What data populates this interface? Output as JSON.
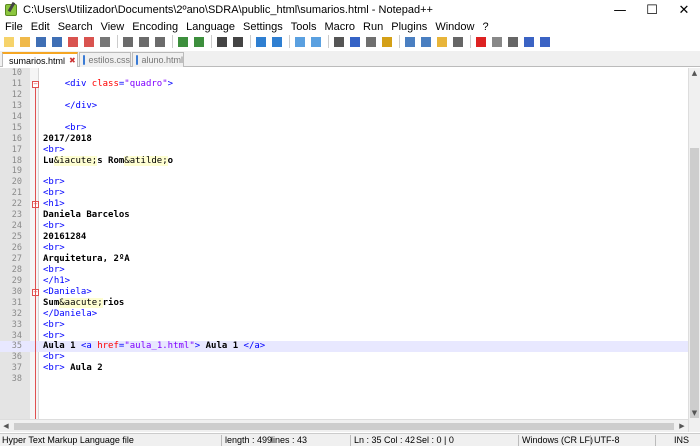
{
  "window": {
    "title": "C:\\Users\\Utilizador\\Documents\\2ºano\\SDRA\\public_html\\sumarios.html - Notepad++",
    "minimize": "—",
    "maximize": "☐",
    "close": "✕"
  },
  "menu": [
    "File",
    "Edit",
    "Search",
    "View",
    "Encoding",
    "Language",
    "Settings",
    "Tools",
    "Macro",
    "Run",
    "Plugins",
    "Window",
    "?"
  ],
  "toolbar_icons": [
    "new-icon",
    "open-icon",
    "save-icon",
    "save-all-icon",
    "close-icon",
    "close-all-icon",
    "print-icon",
    "cut-icon",
    "copy-icon",
    "paste-icon",
    "undo-icon",
    "redo-icon",
    "find-icon",
    "replace-icon",
    "zoom-in-icon",
    "zoom-out-icon",
    "sync-v-icon",
    "sync-h-icon",
    "wrap-icon",
    "all-chars-icon",
    "indent-guide-icon",
    "udl-icon",
    "doc-map-icon",
    "function-list-icon",
    "folder-workspace-icon",
    "monitor-icon",
    "record-icon",
    "stop-icon",
    "play-icon",
    "play-multiple-icon",
    "save-macro-icon"
  ],
  "tabs": [
    {
      "label": "sumarios.html",
      "active": true
    },
    {
      "label": "estilos.css",
      "active": false
    },
    {
      "label": "aluno.html",
      "active": false
    }
  ],
  "code_lines": [
    {
      "n": "10",
      "tokens": []
    },
    {
      "n": "11",
      "tokens": [
        [
          "    ",
          "t"
        ],
        [
          "<div ",
          "tag"
        ],
        [
          "class",
          "attr"
        ],
        [
          "=",
          "tag"
        ],
        [
          "\"quadro\"",
          "str"
        ],
        [
          ">",
          "tag"
        ]
      ]
    },
    {
      "n": "12",
      "tokens": []
    },
    {
      "n": "13",
      "tokens": [
        [
          "    ",
          "t"
        ],
        [
          "</div>",
          "tag"
        ]
      ]
    },
    {
      "n": "14",
      "tokens": []
    },
    {
      "n": "15",
      "tokens": [
        [
          "    ",
          "t"
        ],
        [
          "<br>",
          "tag"
        ]
      ]
    },
    {
      "n": "16",
      "tokens": [
        [
          "2017/2018",
          "txt"
        ]
      ]
    },
    {
      "n": "17",
      "tokens": [
        [
          "<br>",
          "tag"
        ]
      ]
    },
    {
      "n": "18",
      "tokens": [
        [
          "Lu",
          "txt"
        ],
        [
          "&iacute;",
          "ent"
        ],
        [
          "s Rom",
          "txt"
        ],
        [
          "&atilde;",
          "ent"
        ],
        [
          "o",
          "txt"
        ]
      ]
    },
    {
      "n": "19",
      "tokens": []
    },
    {
      "n": "20",
      "tokens": [
        [
          "<br>",
          "tag"
        ]
      ]
    },
    {
      "n": "21",
      "tokens": [
        [
          "<br>",
          "tag"
        ]
      ]
    },
    {
      "n": "22",
      "tokens": [
        [
          "<h1>",
          "tag"
        ]
      ]
    },
    {
      "n": "23",
      "tokens": [
        [
          "Daniela Barcelos",
          "txt"
        ]
      ]
    },
    {
      "n": "24",
      "tokens": [
        [
          "<br>",
          "tag"
        ]
      ]
    },
    {
      "n": "25",
      "tokens": [
        [
          "20161284",
          "txt"
        ]
      ]
    },
    {
      "n": "26",
      "tokens": [
        [
          "<br>",
          "tag"
        ]
      ]
    },
    {
      "n": "27",
      "tokens": [
        [
          "Arquitetura, 2ºA",
          "txt"
        ]
      ]
    },
    {
      "n": "28",
      "tokens": [
        [
          "<br>",
          "tag"
        ]
      ]
    },
    {
      "n": "29",
      "tokens": [
        [
          "</h1>",
          "tag"
        ]
      ]
    },
    {
      "n": "30",
      "tokens": [
        [
          "<Daniela>",
          "tag"
        ]
      ]
    },
    {
      "n": "31",
      "tokens": [
        [
          "Sum",
          "txt"
        ],
        [
          "&aacute;",
          "ent"
        ],
        [
          "rios",
          "txt"
        ]
      ]
    },
    {
      "n": "32",
      "tokens": [
        [
          "</Daniela>",
          "tag"
        ]
      ]
    },
    {
      "n": "33",
      "tokens": [
        [
          "<br>",
          "tag"
        ]
      ]
    },
    {
      "n": "34",
      "tokens": [
        [
          "<br>",
          "tag"
        ]
      ]
    },
    {
      "n": "35",
      "tokens": [
        [
          "Aula 1 ",
          "txt"
        ],
        [
          "<a ",
          "tag"
        ],
        [
          "href",
          "attr"
        ],
        [
          "=",
          "tag"
        ],
        [
          "\"aula_1.html\"",
          "str"
        ],
        [
          ">",
          "tag"
        ],
        [
          " Aula 1 ",
          "txt"
        ],
        [
          "</a>",
          "tag"
        ]
      ],
      "current": true
    },
    {
      "n": "36",
      "tokens": [
        [
          "<br>",
          "tag"
        ]
      ]
    },
    {
      "n": "37",
      "tokens": [
        [
          "<br>",
          "tag"
        ],
        [
          " Aula 2",
          "txt"
        ]
      ]
    },
    {
      "n": "38",
      "tokens": []
    }
  ],
  "status": {
    "filetype": "Hyper Text Markup Language file",
    "length": "length : 499",
    "lines": "lines : 43",
    "ln": "Ln : 35",
    "col": "Col : 42",
    "sel": "Sel : 0 | 0",
    "eol": "Windows (CR LF)",
    "encoding": "UTF-8",
    "mode": "INS"
  }
}
